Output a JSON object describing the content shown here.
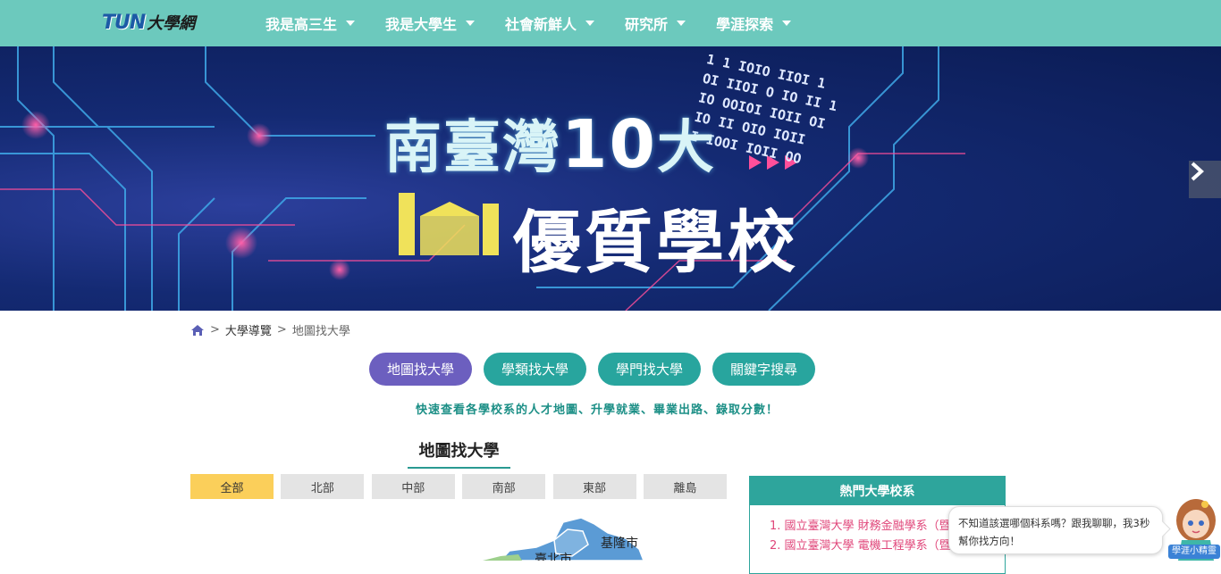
{
  "header": {
    "logo_latin": "TUN",
    "logo_cn": "大學網",
    "nav": [
      {
        "label": "我是高三生"
      },
      {
        "label": "我是大學生"
      },
      {
        "label": "社會新鮮人"
      },
      {
        "label": "研究所"
      },
      {
        "label": "學涯探索"
      }
    ]
  },
  "banner": {
    "title_part1": "南臺灣",
    "title_num": "10",
    "title_part2": "大",
    "subtitle": "優質學校",
    "binary_text": [
      "1 1 IOIO IIOI 1",
      "OI IIOI O IO II 1",
      "IO OOIOI IOII OI",
      "IO II OIO IOII",
      "I IOOI IOII OO"
    ]
  },
  "breadcrumb": {
    "items": [
      {
        "label": "大學導覽"
      }
    ],
    "current": "地圖找大學",
    "separator": ">"
  },
  "tabs": [
    {
      "label": "地圖找大學",
      "active": true
    },
    {
      "label": "學類找大學",
      "active": false
    },
    {
      "label": "學門找大學",
      "active": false
    },
    {
      "label": "關鍵字搜尋",
      "active": false
    }
  ],
  "tagline": "快速查看各學校系的人才地圖、升學就業、畢業出路、錄取分數！",
  "section_title": "地圖找大學",
  "regions": [
    {
      "label": "全部",
      "active": true
    },
    {
      "label": "北部",
      "active": false
    },
    {
      "label": "中部",
      "active": false
    },
    {
      "label": "南部",
      "active": false
    },
    {
      "label": "東部",
      "active": false
    },
    {
      "label": "離島",
      "active": false
    }
  ],
  "map": {
    "labels": [
      "基隆市",
      "臺北市"
    ]
  },
  "hot": {
    "title": "熱門大學校系",
    "items": [
      "1. 國立臺灣大學 財務金融學系（暨研",
      "2. 國立臺灣大學 電機工程學系（暨研"
    ]
  },
  "chat": {
    "message": "不知道該選哪個科系嗎？跟我聊聊，我3秒幫你找方向！",
    "bot_name": "學涯小精靈"
  },
  "colors": {
    "header": "#6cc9bd",
    "tab_active": "#6c5fbf",
    "tab": "#28a59e",
    "region_active": "#fbcf5a",
    "hot_accent": "#2ea59c",
    "hot_text": "#e0467a"
  }
}
